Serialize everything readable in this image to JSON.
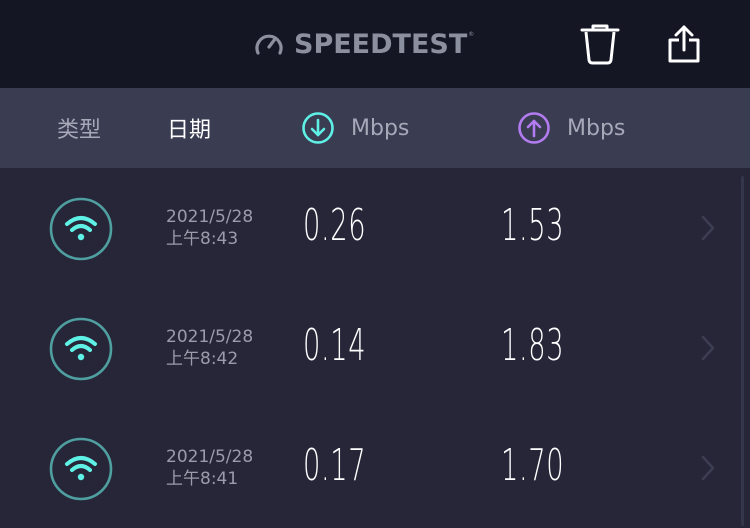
{
  "app": {
    "logo_text": "SPEEDTEST",
    "logo_mark": "®"
  },
  "toolbar": {
    "delete_icon": "trash-icon",
    "share_icon": "share-icon"
  },
  "header": {
    "type_label": "类型",
    "date_label": "日期",
    "download_label": "Mbps",
    "upload_label": "Mbps"
  },
  "colors": {
    "download_accent": "#5ff0e6",
    "upload_accent": "#b27cf0",
    "wifi_ring": "#4f9fa0",
    "wifi_icon": "#5ff0e6"
  },
  "results": [
    {
      "connection_icon": "wifi-icon",
      "date": "2021/5/28",
      "time": "上午8:43",
      "download": "0.26",
      "upload": "1.53"
    },
    {
      "connection_icon": "wifi-icon",
      "date": "2021/5/28",
      "time": "上午8:42",
      "download": "0.14",
      "upload": "1.83"
    },
    {
      "connection_icon": "wifi-icon",
      "date": "2021/5/28",
      "time": "上午8:41",
      "download": "0.17",
      "upload": "1.70"
    }
  ]
}
